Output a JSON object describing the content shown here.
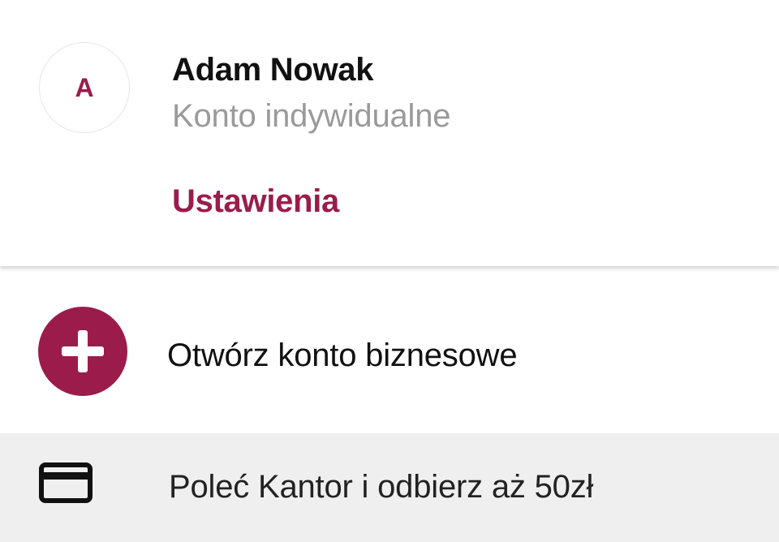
{
  "profile": {
    "avatar_initial": "A",
    "name": "Adam Nowak",
    "account_type": "Konto indywidualne",
    "settings_label": "Ustawienia"
  },
  "menu": {
    "open_business": {
      "label": "Otwórz konto biznesowe",
      "icon": "plus-circle-icon"
    },
    "referral": {
      "label": "Poleć Kantor i odbierz aż 50zł",
      "icon": "credit-card-icon"
    }
  },
  "colors": {
    "accent": "#9b1c4b",
    "text_primary": "#111111",
    "text_secondary": "#9a9a9a",
    "highlight_bg": "#efefef"
  }
}
